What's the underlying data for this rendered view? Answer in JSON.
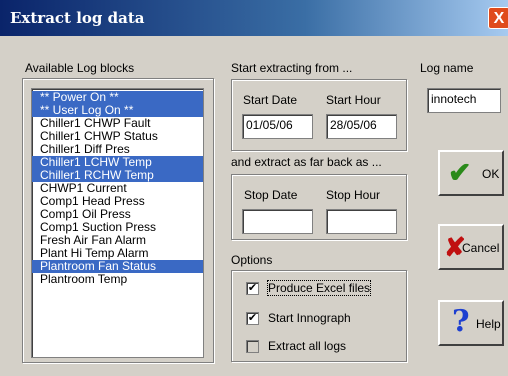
{
  "window": {
    "title": "Extract log data",
    "close_glyph": "X"
  },
  "available": {
    "label": "Available Log blocks",
    "items": [
      {
        "label": "** Power On **",
        "selected": true
      },
      {
        "label": "** User Log On **",
        "selected": true
      },
      {
        "label": "Chiller1 CHWP Fault",
        "selected": false
      },
      {
        "label": "Chiller1 CHWP Status",
        "selected": false
      },
      {
        "label": "Chiller1 Diff Pres",
        "selected": false
      },
      {
        "label": "Chiller1 LCHW Temp",
        "selected": true
      },
      {
        "label": "Chiller1 RCHW Temp",
        "selected": true
      },
      {
        "label": "CHWP1 Current",
        "selected": false
      },
      {
        "label": "Comp1 Head Press",
        "selected": false
      },
      {
        "label": "Comp1 Oil Press",
        "selected": false
      },
      {
        "label": "Comp1 Suction Press",
        "selected": false
      },
      {
        "label": "Fresh Air Fan Alarm",
        "selected": false
      },
      {
        "label": "Plant Hi Temp Alarm",
        "selected": false
      },
      {
        "label": "Plantroom Fan Status",
        "selected": true
      },
      {
        "label": "Plantroom Temp",
        "selected": false
      }
    ]
  },
  "start": {
    "heading": "Start extracting from ...",
    "date_label": "Start Date",
    "hour_label": "Start Hour",
    "date_value": "01/05/06",
    "hour_value": "28/05/06"
  },
  "stop": {
    "heading": "and extract as far back as ...",
    "date_label": "Stop Date",
    "hour_label": "Stop Hour",
    "date_value": "",
    "hour_value": ""
  },
  "log_name": {
    "label": "Log name",
    "value": "innotech"
  },
  "options": {
    "heading": "Options",
    "produce_excel": {
      "label": "Produce Excel files",
      "checked": true
    },
    "start_innograph": {
      "label": "Start Innograph",
      "checked": true
    },
    "extract_all": {
      "label": "Extract all logs",
      "checked": false
    }
  },
  "buttons": {
    "ok": {
      "label": "OK",
      "icon": "checkmark-icon"
    },
    "cancel": {
      "label": "Cancel",
      "icon": "x-mark-icon"
    },
    "help": {
      "label": "Help",
      "icon": "question-mark-icon"
    }
  },
  "colors": {
    "selection": "#3a69c4",
    "title_start": "#0a246a",
    "face": "#d4d0c8"
  }
}
